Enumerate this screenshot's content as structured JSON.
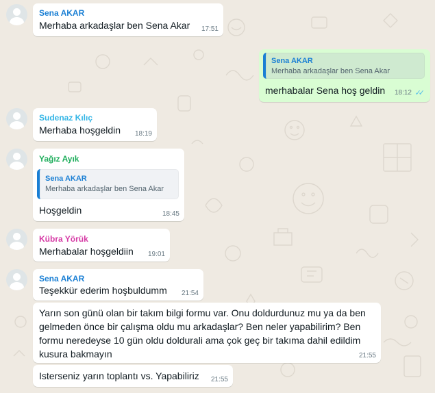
{
  "colors": {
    "sena_akar": "#1a7fd4",
    "sudenaz_kilic": "#35b6e6",
    "yagiz_ayik": "#1fae5c",
    "kubra_yoruk": "#d63aa5",
    "outgoing_bubble": "#d9fdd3",
    "incoming_bubble": "#ffffff",
    "read_ticks": "#53bdeb"
  },
  "messages": [
    {
      "sender": "Sena AKAR",
      "text": "Merhaba arkadaşlar ben Sena Akar",
      "time": "17:51"
    },
    {
      "quote_sender": "Sena AKAR",
      "quote_text": "Merhaba arkadaşlar ben Sena Akar",
      "text": "merhabalar Sena hoş geldin",
      "time": "18:12",
      "status_icon": "double-check-read-icon"
    },
    {
      "sender": "Sudenaz Kılıç",
      "text": "Merhaba hoşgeldin",
      "time": "18:19"
    },
    {
      "sender": "Yağız Ayık",
      "quote_sender": "Sena AKAR",
      "quote_text": "Merhaba arkadaşlar ben Sena Akar",
      "text": "Hoşgeldin",
      "time": "18:45"
    },
    {
      "sender": "Kübra Yörük",
      "text": "Merhabalar hoşgeldiin",
      "time": "19:01"
    },
    {
      "sender": "Sena AKAR",
      "text": "Teşekkür ederim hoşbuldumm",
      "time": "21:54"
    },
    {
      "text": "Yarın son günü olan bir takım bilgi formu var. Onu doldurdunuz mu ya da ben gelmeden önce bir çalışma oldu mu arkadaşlar? Ben neler yapabilirim? Ben formu neredeyse 10 gün oldu doldurali ama çok geç bir takıma dahil edildim kusura bakmayın",
      "time": "21:55"
    },
    {
      "text": "Isterseniz yarın toplantı vs. Yapabiliriz",
      "time": "21:55"
    }
  ]
}
